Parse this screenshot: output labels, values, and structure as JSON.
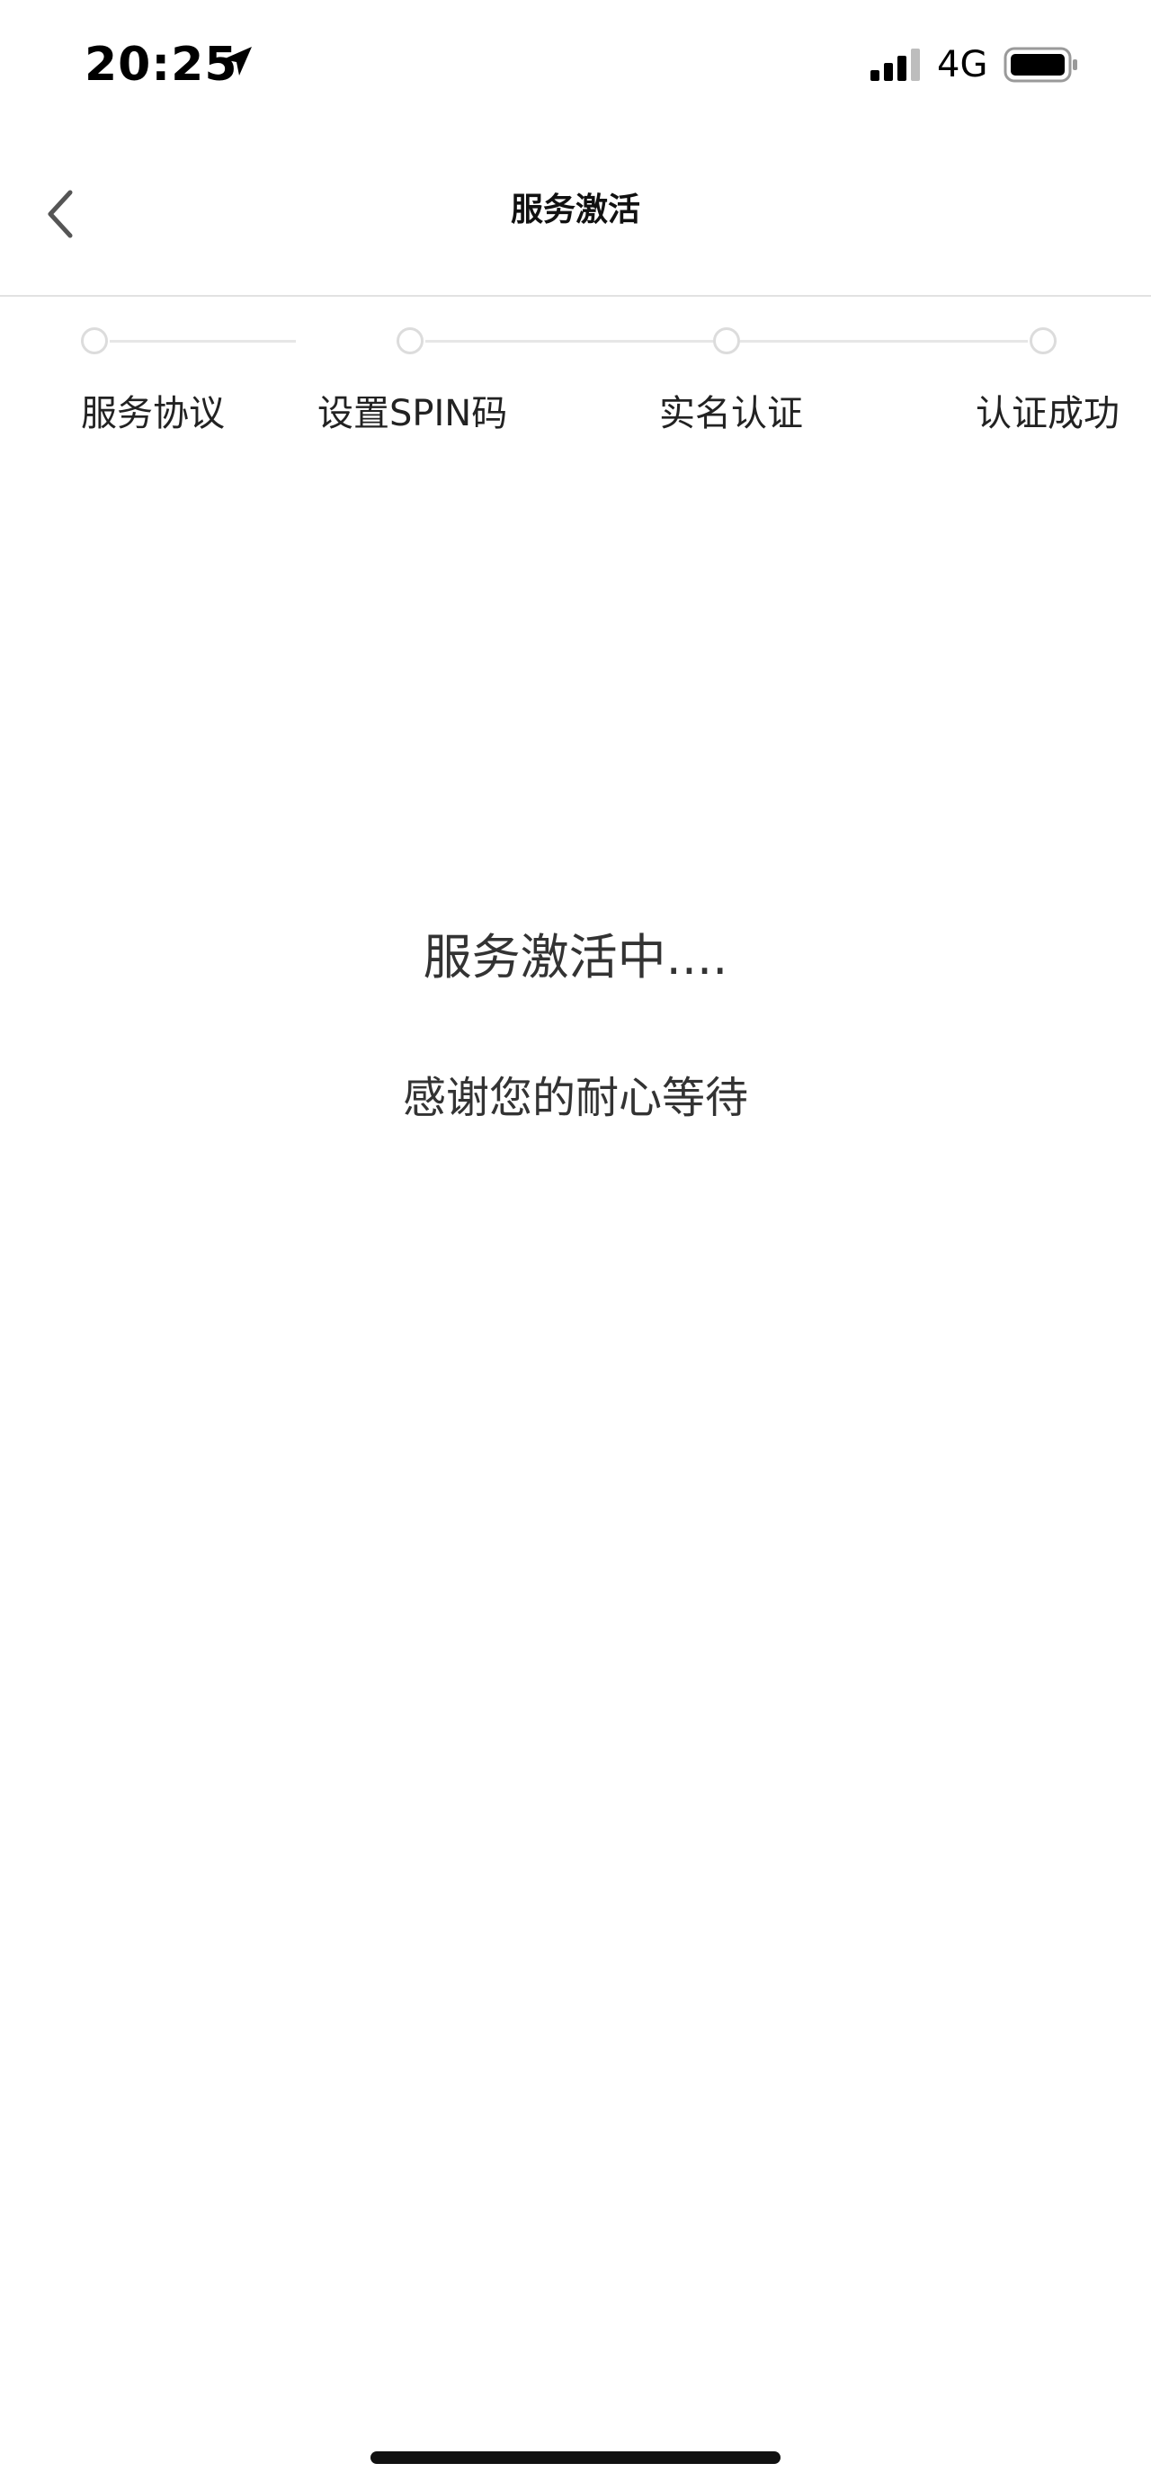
{
  "status_bar": {
    "time": "20:25",
    "network": "4G",
    "icons": [
      "location-arrow-icon",
      "cellular-signal-icon",
      "battery-icon"
    ]
  },
  "nav": {
    "title": "服务激活",
    "back_icon": "chevron-left-icon"
  },
  "stepper": {
    "steps": [
      {
        "label": "服务协议"
      },
      {
        "label": "设置SPIN码"
      },
      {
        "label": "实名认证"
      },
      {
        "label": "认证成功"
      }
    ]
  },
  "main": {
    "status": "服务激活中....",
    "subtext": "感谢您的耐心等待"
  },
  "colors": {
    "background": "#ffffff",
    "text": "#333333",
    "divider": "#e2e2e2",
    "step_dot_border": "#dcdcdc"
  }
}
